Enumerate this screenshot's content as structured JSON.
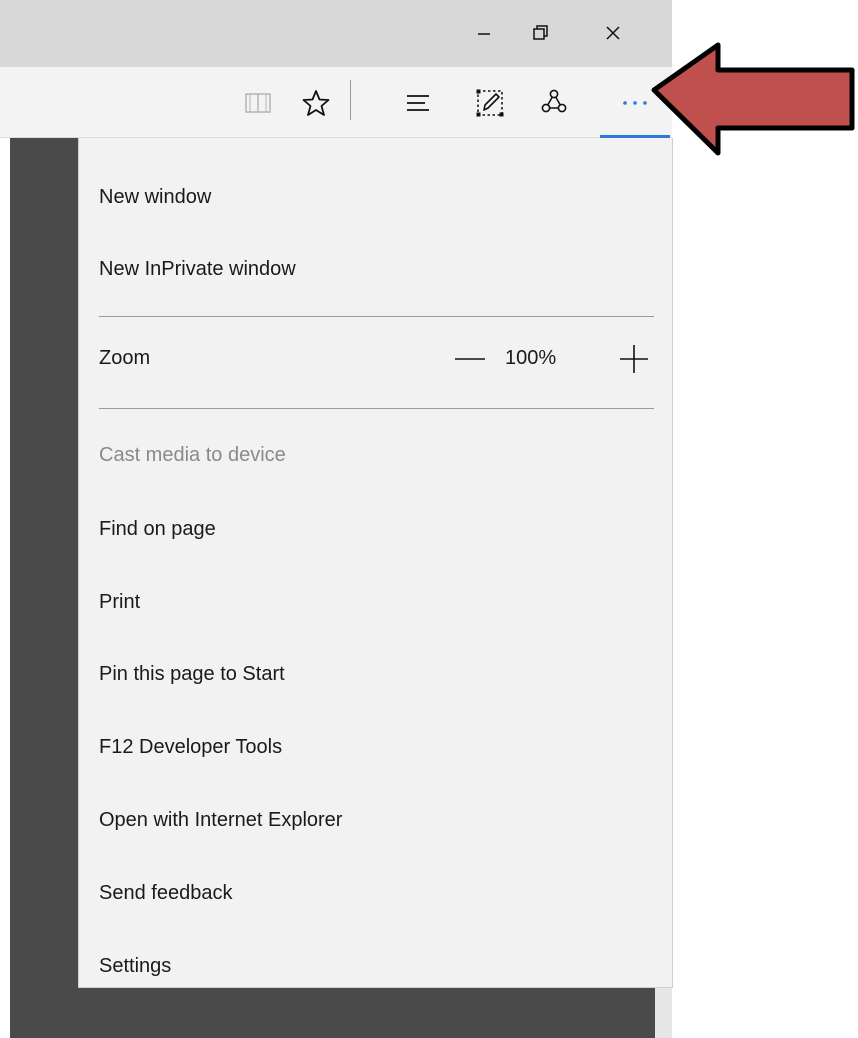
{
  "window": {
    "minimize_icon": "minimize-icon",
    "restore_icon": "restore-icon",
    "close_icon": "close-icon"
  },
  "toolbar": {
    "icons": [
      "reading-view-icon",
      "favorites-star-icon",
      "hub-icon",
      "web-note-icon",
      "share-icon",
      "more-actions-icon"
    ],
    "active_color": "#2b7ad9"
  },
  "menu": {
    "new_window": "New window",
    "new_inprivate": "New InPrivate window",
    "zoom_label": "Zoom",
    "zoom_value": "100%",
    "cast": "Cast media to device",
    "find": "Find on page",
    "print": "Print",
    "pin": "Pin this page to Start",
    "devtools": "F12 Developer Tools",
    "open_ie": "Open with Internet Explorer",
    "feedback": "Send feedback",
    "settings": "Settings"
  },
  "annotation": {
    "arrow_color": "#c0504d"
  }
}
